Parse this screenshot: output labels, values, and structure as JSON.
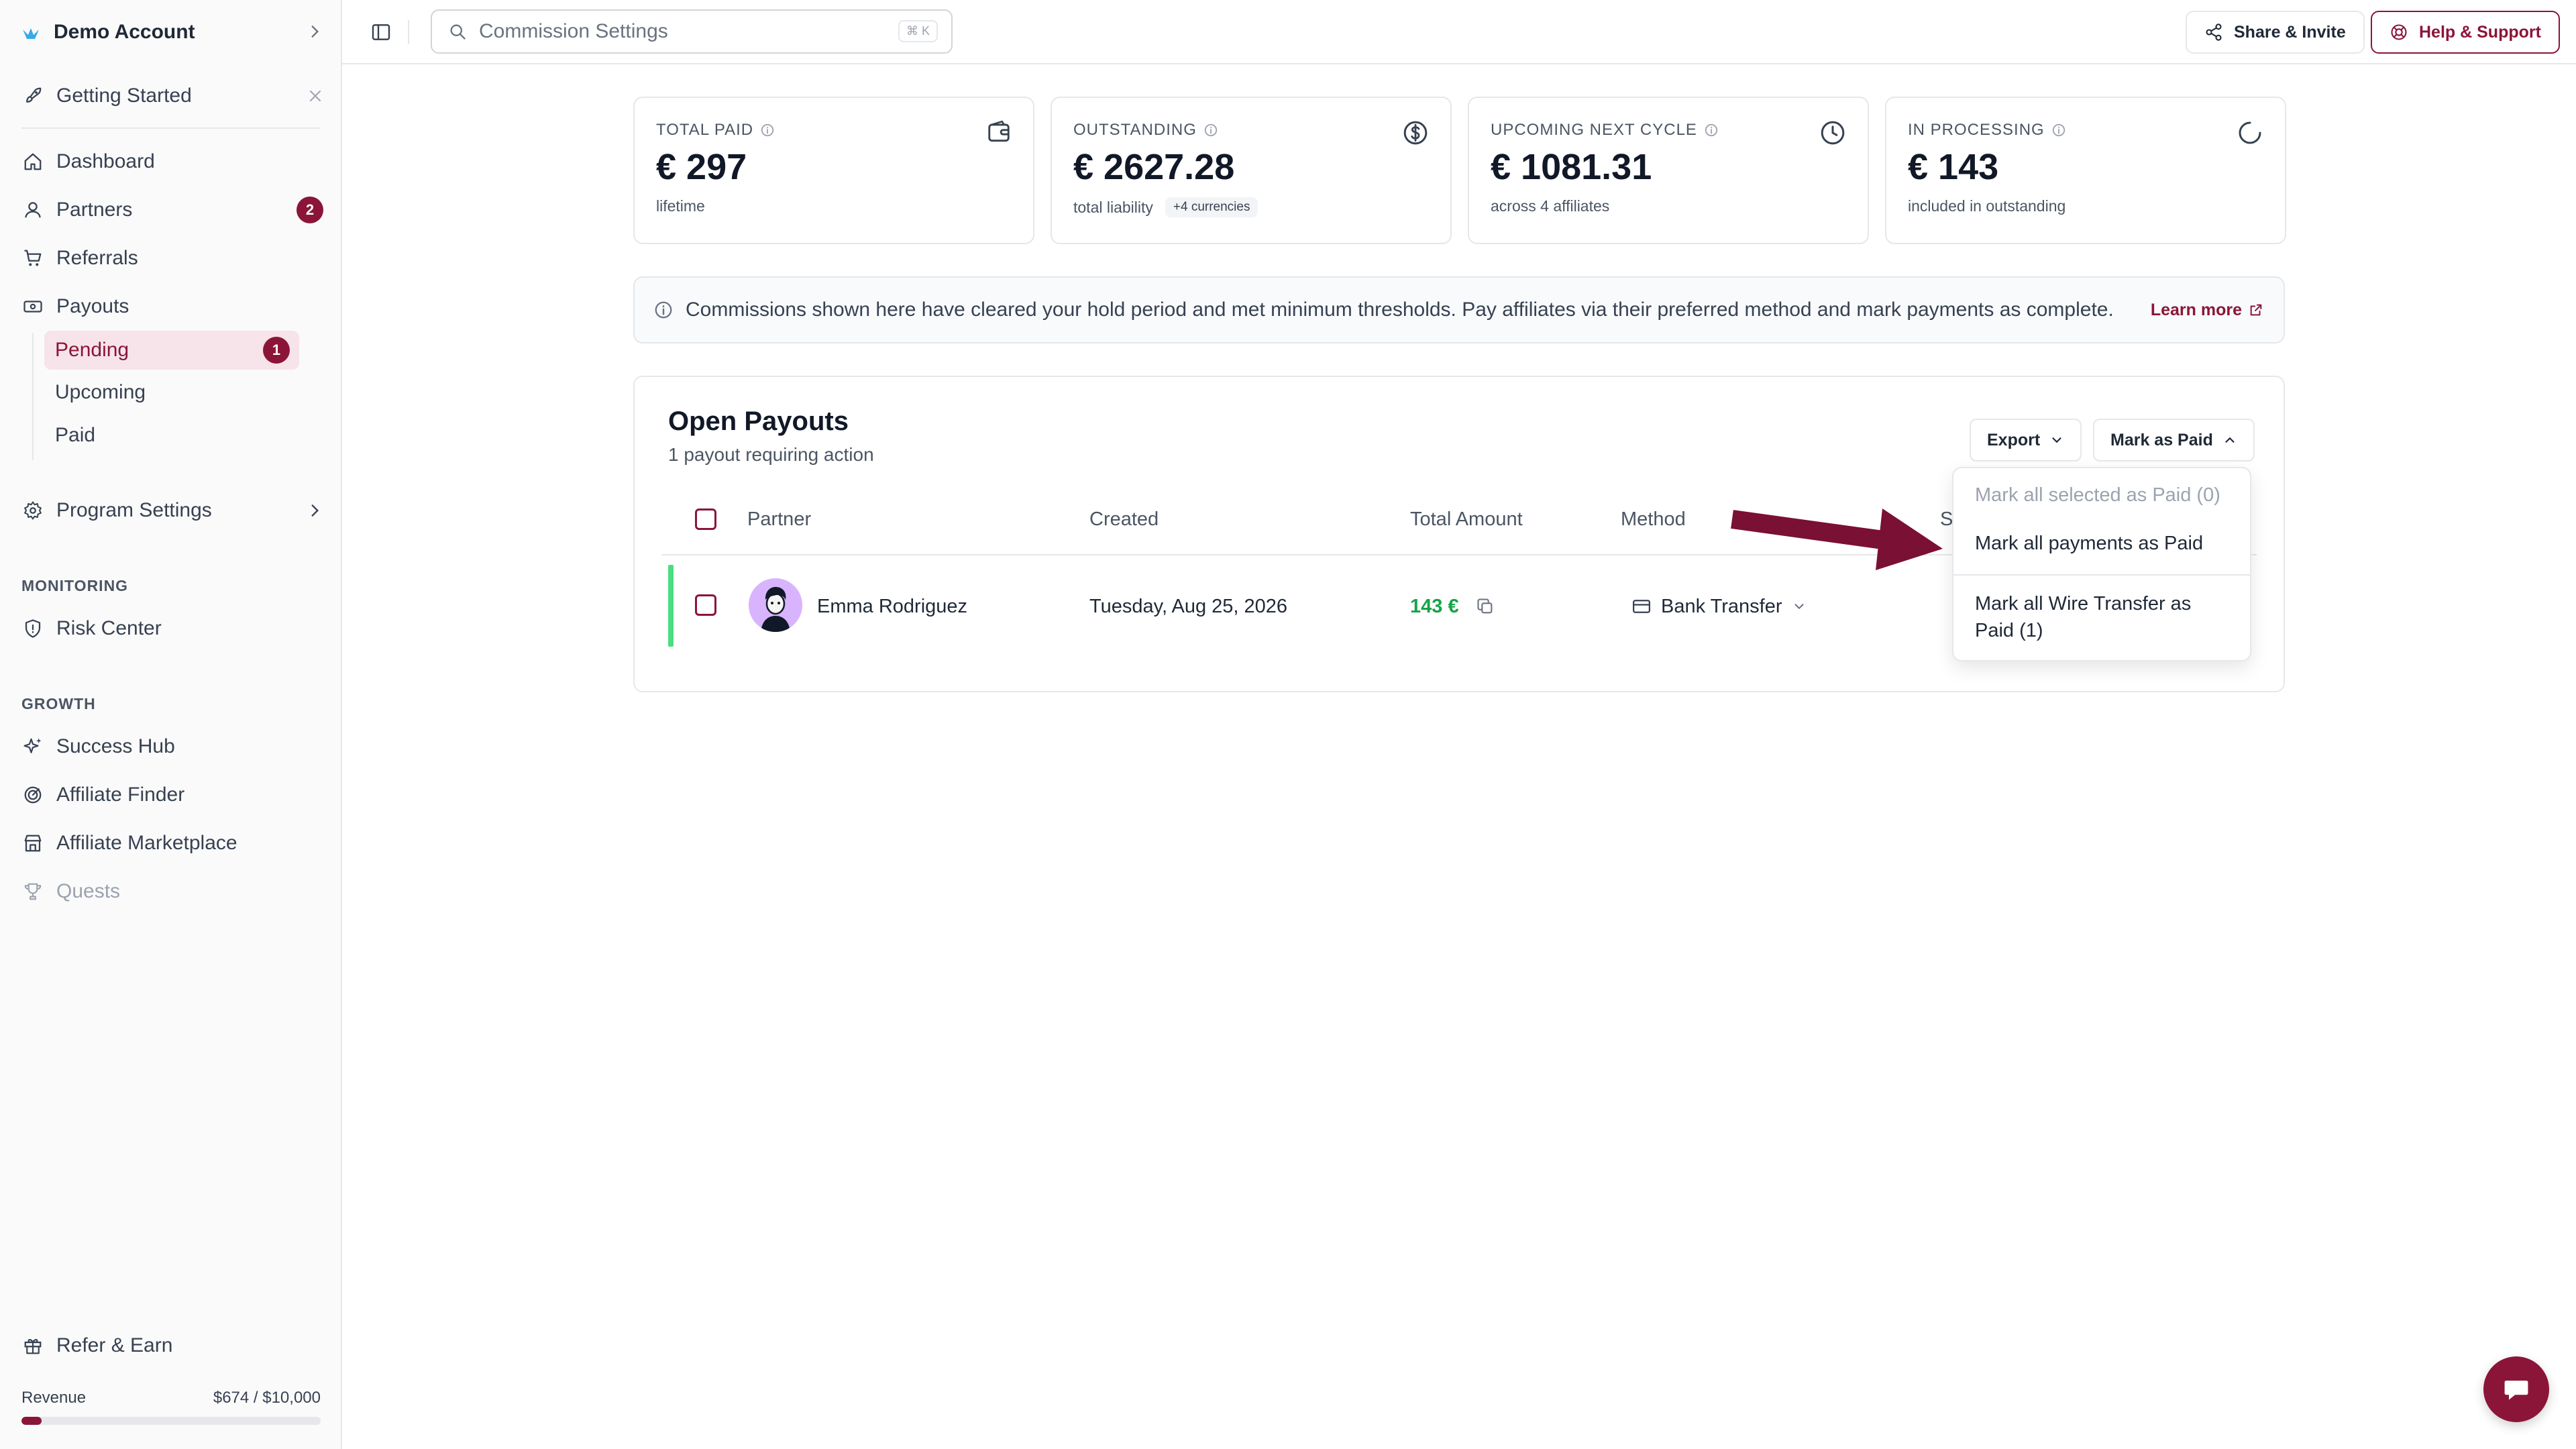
{
  "account": {
    "name": "Demo Account"
  },
  "getting_started": {
    "label": "Getting Started"
  },
  "nav": {
    "dashboard": "Dashboard",
    "partners": "Partners",
    "partners_badge": "2",
    "referrals": "Referrals",
    "payouts": "Payouts",
    "payouts_sub": [
      {
        "label": "Pending",
        "badge": "1",
        "active": true
      },
      {
        "label": "Upcoming"
      },
      {
        "label": "Paid"
      }
    ],
    "program_settings": "Program Settings"
  },
  "sections": {
    "monitoring": "MONITORING",
    "risk_center": "Risk Center",
    "growth": "GROWTH",
    "success_hub": "Success Hub",
    "affiliate_finder": "Affiliate Finder",
    "affiliate_marketplace": "Affiliate Marketplace",
    "quests": "Quests"
  },
  "footer": {
    "refer_earn": "Refer & Earn",
    "revenue_label": "Revenue",
    "revenue_value": "$674 / $10,000",
    "revenue_progress": 0.0674
  },
  "topbar": {
    "search_placeholder": "Commission Settings",
    "search_shortcut": "⌘ K",
    "share_label": "Share & Invite",
    "help_label": "Help & Support"
  },
  "stats": [
    {
      "label": "TOTAL PAID",
      "value": "€ 297",
      "sub": "lifetime",
      "icon": "wallet-icon"
    },
    {
      "label": "OUTSTANDING",
      "value": "€ 2627.28",
      "sub": "total liability",
      "chip": "+4 currencies",
      "icon": "dollar-circle-icon"
    },
    {
      "label": "UPCOMING NEXT CYCLE",
      "value": "€ 1081.31",
      "sub": "across 4 affiliates",
      "icon": "clock-icon"
    },
    {
      "label": "IN PROCESSING",
      "value": "€ 143",
      "sub": "included in outstanding",
      "icon": "loader-icon"
    }
  ],
  "banner": {
    "text": "Commissions shown here have cleared your hold period and met minimum thresholds. Pay affiliates via their preferred method and mark payments as complete.",
    "link": "Learn more"
  },
  "payouts": {
    "title": "Open Payouts",
    "subtitle": "1 payout requiring action",
    "export_label": "Export",
    "mark_paid_label": "Mark as Paid",
    "columns": [
      "Partner",
      "Created",
      "Total Amount",
      "Method",
      "S"
    ],
    "rows": [
      {
        "partner": "Emma Rodriguez",
        "created": "Tuesday, Aug 25, 2026",
        "amount": "143 €",
        "method": "Bank Transfer"
      }
    ]
  },
  "dropdown": {
    "items": [
      "Mark all selected as Paid (0)",
      "Mark all payments as Paid",
      "Mark all Wire Transfer as",
      "Paid (1)"
    ]
  },
  "colors": {
    "brand": "#8b1538",
    "success": "#16a34a",
    "row_accent": "#4ade80"
  }
}
